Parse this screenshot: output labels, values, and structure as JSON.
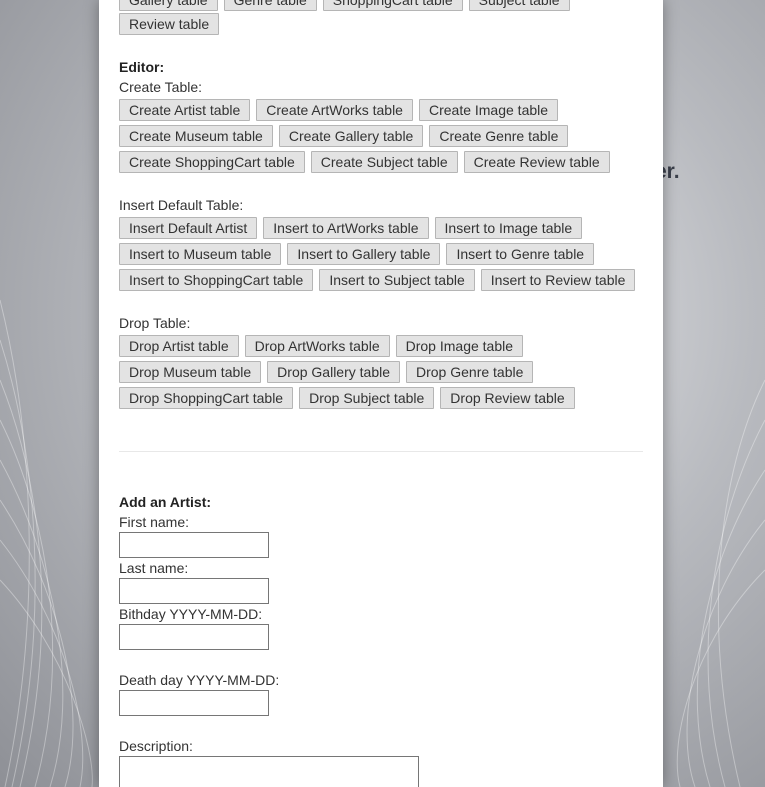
{
  "background": {
    "partial_text": "er."
  },
  "top_buttons": [
    "Gallery table",
    "Genre table",
    "ShoppingCart table",
    "Subject table"
  ],
  "review_button": "Review table",
  "editor": {
    "heading": "Editor:",
    "create": {
      "label": "Create Table:",
      "rows": [
        [
          "Create Artist table",
          "Create ArtWorks table",
          "Create Image table"
        ],
        [
          "Create Museum table",
          "Create Gallery table",
          "Create Genre table"
        ],
        [
          "Create ShoppingCart table",
          "Create Subject table",
          "Create Review table"
        ]
      ]
    },
    "insert": {
      "label": "Insert Default Table:",
      "rows": [
        [
          "Insert Default Artist",
          "Insert to ArtWorks table",
          "Insert to Image table"
        ],
        [
          "Insert to Museum table",
          "Insert to Gallery table",
          "Insert to Genre table"
        ],
        [
          "Insert to ShoppingCart table",
          "Insert to Subject table",
          "Insert to Review table"
        ]
      ]
    },
    "drop": {
      "label": "Drop Table:",
      "rows": [
        [
          "Drop Artist table",
          "Drop ArtWorks table",
          "Drop Image table"
        ],
        [
          "Drop Museum table",
          "Drop Gallery table",
          "Drop Genre table"
        ],
        [
          "Drop ShoppingCart table",
          "Drop Subject table",
          "Drop Review table"
        ]
      ]
    }
  },
  "artist_form": {
    "heading": "Add an Artist:",
    "first_name_label": "First name:",
    "last_name_label": "Last name:",
    "birthday_label": "Bithday YYYY-MM-DD:",
    "deathday_label": "Death day YYYY-MM-DD:",
    "description_label": "Description:",
    "first_name_value": "",
    "last_name_value": "",
    "birthday_value": "",
    "deathday_value": "",
    "description_value": ""
  }
}
